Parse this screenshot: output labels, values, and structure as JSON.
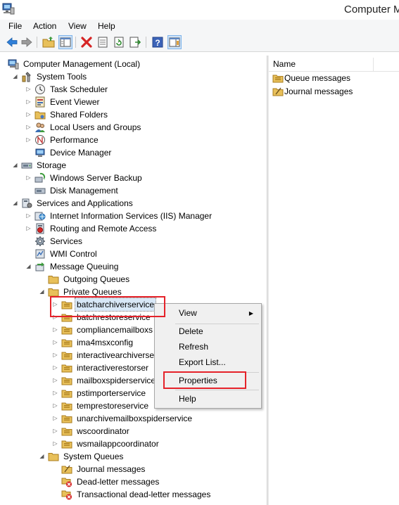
{
  "window": {
    "title": "Computer M"
  },
  "menu": [
    {
      "label": "File"
    },
    {
      "label": "Action"
    },
    {
      "label": "View"
    },
    {
      "label": "Help"
    }
  ],
  "toolbar": {
    "icons": [
      "back-arrow-icon",
      "forward-arrow-icon",
      "up-folder-icon",
      "show-hide-console-tree-icon",
      "delete-icon",
      "properties-icon",
      "refresh-icon",
      "export-list-icon",
      "help-icon",
      "show-hide-action-pane-icon"
    ]
  },
  "tree": {
    "root": "Computer Management (Local)",
    "system_tools": {
      "label": "System Tools",
      "children": [
        "Task Scheduler",
        "Event Viewer",
        "Shared Folders",
        "Local Users and Groups",
        "Performance",
        "Device Manager"
      ]
    },
    "storage": {
      "label": "Storage",
      "children": [
        "Windows Server Backup",
        "Disk Management"
      ]
    },
    "services_apps": {
      "label": "Services and Applications",
      "children": [
        "Internet Information Services (IIS) Manager",
        "Routing and Remote Access",
        "Services",
        "WMI Control"
      ]
    },
    "message_queuing": {
      "label": "Message Queuing",
      "outgoing": "Outgoing Queues",
      "private": "Private Queues",
      "private_queues": [
        "batcharchiverservice",
        "batchrestoreservice",
        "compliancemailboxs",
        "ima4msxconfig",
        "interactivearchiverse",
        "interactiverestorser",
        "mailboxspiderservice",
        "pstimporterservice",
        "temprestoreservice",
        "unarchivemailboxspiderservice",
        "wscoordinator",
        "wsmailappcoordinator"
      ],
      "system": "System Queues",
      "system_queues": [
        "Journal messages",
        "Dead-letter messages",
        "Transactional dead-letter messages"
      ]
    }
  },
  "list": {
    "column": "Name",
    "items": [
      "Queue messages",
      "Journal messages"
    ]
  },
  "context_menu": {
    "view": "View",
    "delete": "Delete",
    "refresh": "Refresh",
    "export": "Export List...",
    "properties": "Properties",
    "help": "Help"
  },
  "colors": {
    "highlight": "#e5222a",
    "selection": "#d8e8f7",
    "folder": "#e8c05a"
  }
}
